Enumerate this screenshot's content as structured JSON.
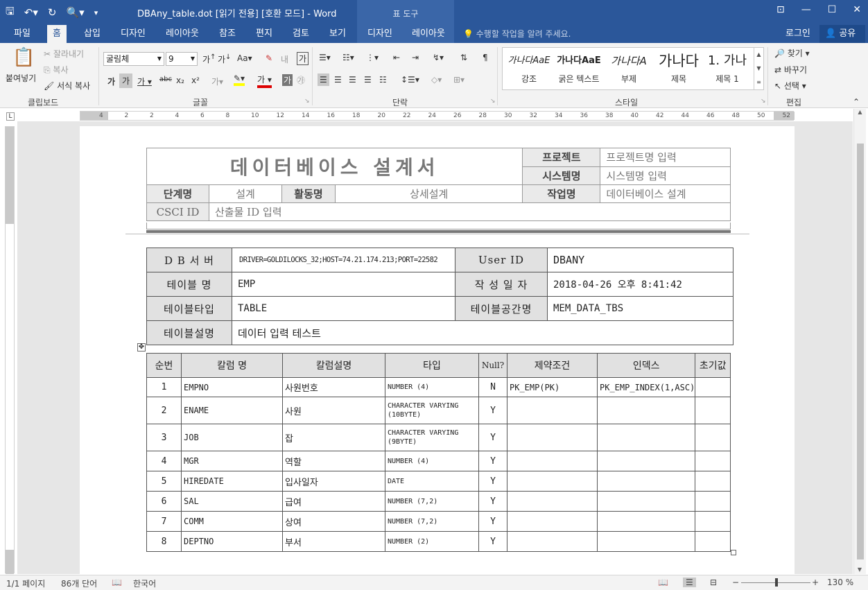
{
  "window": {
    "title": "DBAny_table.dot [읽기 전용] [호환 모드] - Word",
    "context_header": "표 도구",
    "restore_ribbon_icon": "ribbon-display-icon",
    "minimize_icon": "minimize-icon",
    "maximize_icon": "maximize-icon",
    "close_icon": "close-icon"
  },
  "tabs": [
    "파일",
    "홈",
    "삽입",
    "디자인",
    "레이아웃",
    "참조",
    "편지",
    "검토",
    "보기",
    "디자인",
    "레이아웃"
  ],
  "tell_me": "수행할 작업을 알려 주세요.",
  "signin": "로그인",
  "share": "공유",
  "clipboard": {
    "paste": "붙여넣기",
    "cut": "잘라내기",
    "copy": "복사",
    "format_painter": "서식 복사",
    "label": "클립보드"
  },
  "font": {
    "name": "굴림체",
    "size": "9",
    "label": "글꼴",
    "aa": "Aa",
    "bold": "가",
    "italic": "가",
    "underline": "가",
    "strike": "abc",
    "sub": "x₂",
    "sup": "x²",
    "grow": "가",
    "shrink": "가",
    "color_a": "가"
  },
  "paragraph": {
    "label": "단락"
  },
  "styles": {
    "label": "스타일",
    "items": [
      {
        "preview": "가나다AaE",
        "name": "강조"
      },
      {
        "preview": "가나다AaE",
        "name": "굵은 텍스트"
      },
      {
        "preview": "가나다A",
        "name": "부제"
      },
      {
        "preview": "가나다",
        "name": "제목"
      },
      {
        "preview": "1. 가나",
        "name": "제목 1"
      }
    ]
  },
  "editing": {
    "find": "찾기",
    "replace": "바꾸기",
    "select": "선택",
    "label": "편집"
  },
  "status": {
    "page": "1/1 페이지",
    "words": "86개 단어",
    "lang": "한국어",
    "zoom": "130 %"
  },
  "doc": {
    "header": {
      "title": "데이터베이스 설계서",
      "project_label": "프로젝트",
      "project_value": "프로젝트명 입력",
      "system_label": "시스템명",
      "system_value": "시스템명 입력",
      "stage_label": "단계명",
      "stage_value": "설계",
      "activity_label": "활동명",
      "activity_value": "상세설계",
      "task_label": "작업명",
      "task_value": "데이터베이스 설계",
      "csci_label": "CSCI ID",
      "csci_value": "산출물 ID 입력"
    },
    "info": {
      "db_server_label": "D B 서 버",
      "db_server_value": "DRIVER=GOLDILOCKS_32;HOST=74.21.174.213;PORT=22582",
      "user_label": "User ID",
      "user_value": "DBANY",
      "table_name_label": "테이블 명",
      "table_name_value": "EMP",
      "created_label": "작 성 일 자",
      "created_value": "2018-04-26 오후 8:41:42",
      "table_type_label": "테이블타입",
      "table_type_value": "TABLE",
      "tablespace_label": "테이블공간명",
      "tablespace_value": "MEM_DATA_TBS",
      "desc_label": "테이블설명",
      "desc_value": "데이터 입력 테스트"
    },
    "columns_head": [
      "순번",
      "칼럼 명",
      "칼럼설명",
      "타입",
      "Null?",
      "제약조건",
      "인덱스",
      "초기값"
    ],
    "columns": [
      {
        "no": "1",
        "name": "EMPNO",
        "desc": "사원번호",
        "type": "NUMBER (4)",
        "null": "N",
        "cons": "PK_EMP(PK)",
        "idx": "PK_EMP_INDEX(1,ASC)",
        "def": ""
      },
      {
        "no": "2",
        "name": "ENAME",
        "desc": "사원",
        "type": "CHARACTER VARYING (10BYTE)",
        "null": "Y",
        "cons": "",
        "idx": "",
        "def": ""
      },
      {
        "no": "3",
        "name": "JOB",
        "desc": "잡",
        "type": "CHARACTER VARYING (9BYTE)",
        "null": "Y",
        "cons": "",
        "idx": "",
        "def": ""
      },
      {
        "no": "4",
        "name": "MGR",
        "desc": "역할",
        "type": "NUMBER (4)",
        "null": "Y",
        "cons": "",
        "idx": "",
        "def": ""
      },
      {
        "no": "5",
        "name": "HIREDATE",
        "desc": "입사일자",
        "type": "DATE",
        "null": "Y",
        "cons": "",
        "idx": "",
        "def": ""
      },
      {
        "no": "6",
        "name": "SAL",
        "desc": "급여",
        "type": "NUMBER (7,2)",
        "null": "Y",
        "cons": "",
        "idx": "",
        "def": ""
      },
      {
        "no": "7",
        "name": "COMM",
        "desc": "상여",
        "type": "NUMBER (7,2)",
        "null": "Y",
        "cons": "",
        "idx": "",
        "def": ""
      },
      {
        "no": "8",
        "name": "DEPTNO",
        "desc": "부서",
        "type": "NUMBER (2)",
        "null": "Y",
        "cons": "",
        "idx": "",
        "def": ""
      }
    ]
  },
  "ruler_numbers": [
    "4",
    "2",
    "2",
    "4",
    "6",
    "8",
    "10",
    "12",
    "14",
    "16",
    "18",
    "20",
    "22",
    "24",
    "26",
    "28",
    "30",
    "32",
    "34",
    "36",
    "38",
    "40",
    "42",
    "44",
    "46",
    "48",
    "50",
    "52"
  ]
}
